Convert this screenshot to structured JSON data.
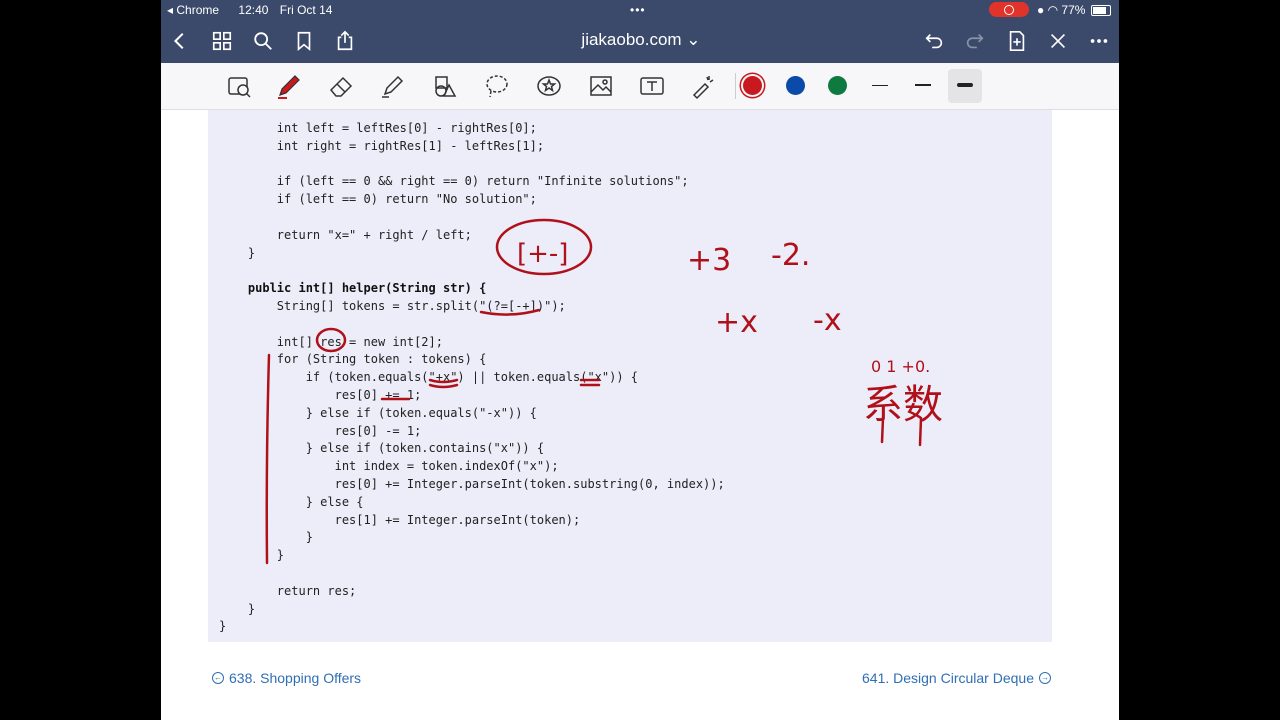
{
  "status": {
    "browser": "Chrome",
    "time": "12:40",
    "date": "Fri Oct 14",
    "battery": "77%"
  },
  "nav": {
    "url": "jiakaobo.com ⌄"
  },
  "toolbar": {
    "colors": [
      "#c8191e",
      "#0b4aa8",
      "#0f7a3f"
    ],
    "tools": [
      "lasso-zoom-icon",
      "pen-icon",
      "eraser-icon",
      "highlighter-icon",
      "shapes-icon",
      "lasso-icon",
      "sticker-icon",
      "image-icon",
      "text-icon",
      "laser-icon"
    ]
  },
  "code": {
    "lines": [
      "        int left = leftRes[0] - rightRes[0];",
      "        int right = rightRes[1] - leftRes[1];",
      "",
      "        if (left == 0 && right == 0) return \"Infinite solutions\";",
      "        if (left == 0) return \"No solution\";",
      "",
      "        return \"x=\" + right / left;",
      "    }",
      "",
      "    public int[] helper(String str) {",
      "        String[] tokens = str.split(\"(?=[-+])\");",
      "",
      "        int[] res = new int[2];",
      "        for (String token : tokens) {",
      "            if (token.equals(\"+x\") || token.equals(\"x\")) {",
      "                res[0] += 1;",
      "            } else if (token.equals(\"-x\")) {",
      "                res[0] -= 1;",
      "            } else if (token.contains(\"x\")) {",
      "                int index = token.indexOf(\"x\");",
      "                res[0] += Integer.parseInt(token.substring(0, index));",
      "            } else {",
      "                res[1] += Integer.parseInt(token);",
      "            }",
      "        }",
      "",
      "        return res;",
      "    }",
      "}"
    ]
  },
  "annotations": {
    "bracket": "[+-]",
    "plus3": "+3",
    "minus2": "-2.",
    "plusx": "+x",
    "minusx": "-x",
    "digits": "0 1 +0.",
    "chinese": "系数"
  },
  "footer": {
    "prev": "638. Shopping Offers",
    "next": "641. Design Circular Deque"
  }
}
